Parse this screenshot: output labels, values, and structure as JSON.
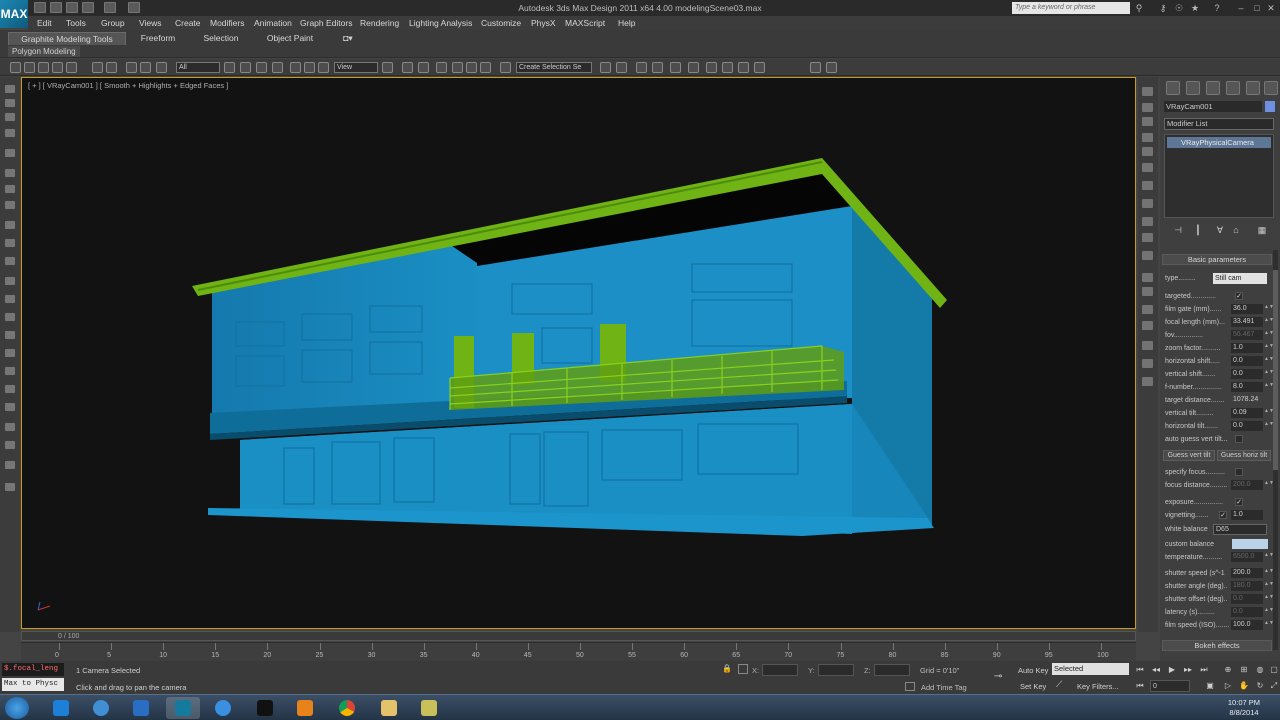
{
  "window": {
    "title": "Autodesk 3ds Max Design 2011 x64     4.00 modelingScene03.max",
    "app_logo": "MAX",
    "search_placeholder": "Type a keyword or phrase"
  },
  "menu": [
    "Edit",
    "Tools",
    "Group",
    "Views",
    "Create",
    "Modifiers",
    "Animation",
    "Graph Editors",
    "Rendering",
    "Lighting Analysis",
    "Customize",
    "PhysX",
    "MAXScript",
    "Help"
  ],
  "ribbon": {
    "tabs": [
      "Graphite Modeling Tools",
      "Freeform",
      "Selection",
      "Object Paint"
    ],
    "active_panel": "Polygon Modeling"
  },
  "toolbar": {
    "selection_filter": "All",
    "ref_coord": "View",
    "named_selection": "Create Selection Se"
  },
  "viewport": {
    "label": "[ + ] [ VRayCam001 ] [ Smooth + Highlights + Edged Faces ]",
    "colors": {
      "building": "#1a8fc4",
      "accent": "#6fb314",
      "background": "#121212",
      "border": "#c79b1e"
    }
  },
  "timeline": {
    "frame_counter": "0 / 100",
    "ticks": [
      "0",
      "5",
      "10",
      "15",
      "20",
      "25",
      "30",
      "35",
      "40",
      "45",
      "50",
      "55",
      "60",
      "65",
      "70",
      "75",
      "80",
      "85",
      "90",
      "95",
      "100"
    ]
  },
  "status": {
    "script_line1": "$.focal_leng",
    "script_line2": "Max to Physc",
    "selected_text": "1 Camera Selected",
    "prompt_text": "Click and drag to pan the camera",
    "x_label": "X:",
    "y_label": "Y:",
    "z_label": "Z:",
    "grid_text": "Grid = 0'10\"",
    "add_time_tag": "Add Time Tag",
    "auto_key": "Auto Key",
    "set_key": "Set Key",
    "key_filters": "Key Filters...",
    "selected_dropdown": "Selected",
    "frame_field": "0"
  },
  "command_panel": {
    "object_name": "VRayCam001",
    "modifier_list": "Modifier List",
    "stack_item": "VRayPhysicalCamera",
    "rollout_title": "Basic parameters",
    "type_label": "type.........",
    "type_value": "Still cam",
    "params": [
      {
        "label": "targeted.............",
        "kind": "check",
        "value": "✓"
      },
      {
        "label": "film gate (mm)......",
        "kind": "num",
        "value": "36.0"
      },
      {
        "label": "focal length (mm)...",
        "kind": "num",
        "value": "33.491"
      },
      {
        "label": "fov...............",
        "kind": "numdim",
        "value": "56.467"
      },
      {
        "label": "zoom factor..........",
        "kind": "num",
        "value": "1.0"
      },
      {
        "label": "horizontal shift.....",
        "kind": "num",
        "value": "0.0"
      },
      {
        "label": "vertical shift.......",
        "kind": "num",
        "value": "0.0"
      },
      {
        "label": "f-number...............",
        "kind": "num",
        "value": "8.0"
      },
      {
        "label": "target distance.......",
        "kind": "text",
        "value": "1078.24"
      },
      {
        "label": "vertical tilt.........",
        "kind": "num",
        "value": "0.09"
      },
      {
        "label": "horizontal tilt.......",
        "kind": "num",
        "value": "0.0"
      },
      {
        "label": "auto guess vert tilt...",
        "kind": "check",
        "value": ""
      }
    ],
    "guess_vert": "Guess vert tilt",
    "guess_horiz": "Guess horiz tilt",
    "params2": [
      {
        "label": "specify focus..........",
        "kind": "check",
        "value": ""
      },
      {
        "label": "focus distance.........",
        "kind": "numdim",
        "value": "200.0"
      },
      {
        "label": "exposure...............",
        "kind": "check",
        "value": "✓"
      },
      {
        "label": "vignetting.......",
        "kind": "checknum",
        "value": "1.0"
      },
      {
        "label": "white balance",
        "kind": "dropdown",
        "value": "D65"
      },
      {
        "label": "custom balance",
        "kind": "swatch",
        "value": ""
      },
      {
        "label": "temperature..........",
        "kind": "numdim",
        "value": "6500.0"
      },
      {
        "label": "shutter speed (s^-1",
        "kind": "num",
        "value": "200.0"
      },
      {
        "label": "shutter angle (deg)..",
        "kind": "numdim",
        "value": "180.0"
      },
      {
        "label": "shutter offset (deg)..",
        "kind": "numdim",
        "value": "0.0"
      },
      {
        "label": "latency (s).........",
        "kind": "numdim",
        "value": "0.0"
      },
      {
        "label": "film speed (ISO).......",
        "kind": "num",
        "value": "100.0"
      }
    ],
    "bokeh_title": "Bokeh effects"
  },
  "taskbar": {
    "clock_time": "10:07 PM",
    "clock_date": "8/8/2014",
    "apps": [
      "windows-media-icon",
      "ie-icon",
      "cd-icon",
      "outlook-icon",
      "3dsmax-icon",
      "itunes-icon",
      "steam-icon",
      "media-player-icon",
      "chrome-icon",
      "explorer-icon",
      "sketchup-icon"
    ]
  }
}
